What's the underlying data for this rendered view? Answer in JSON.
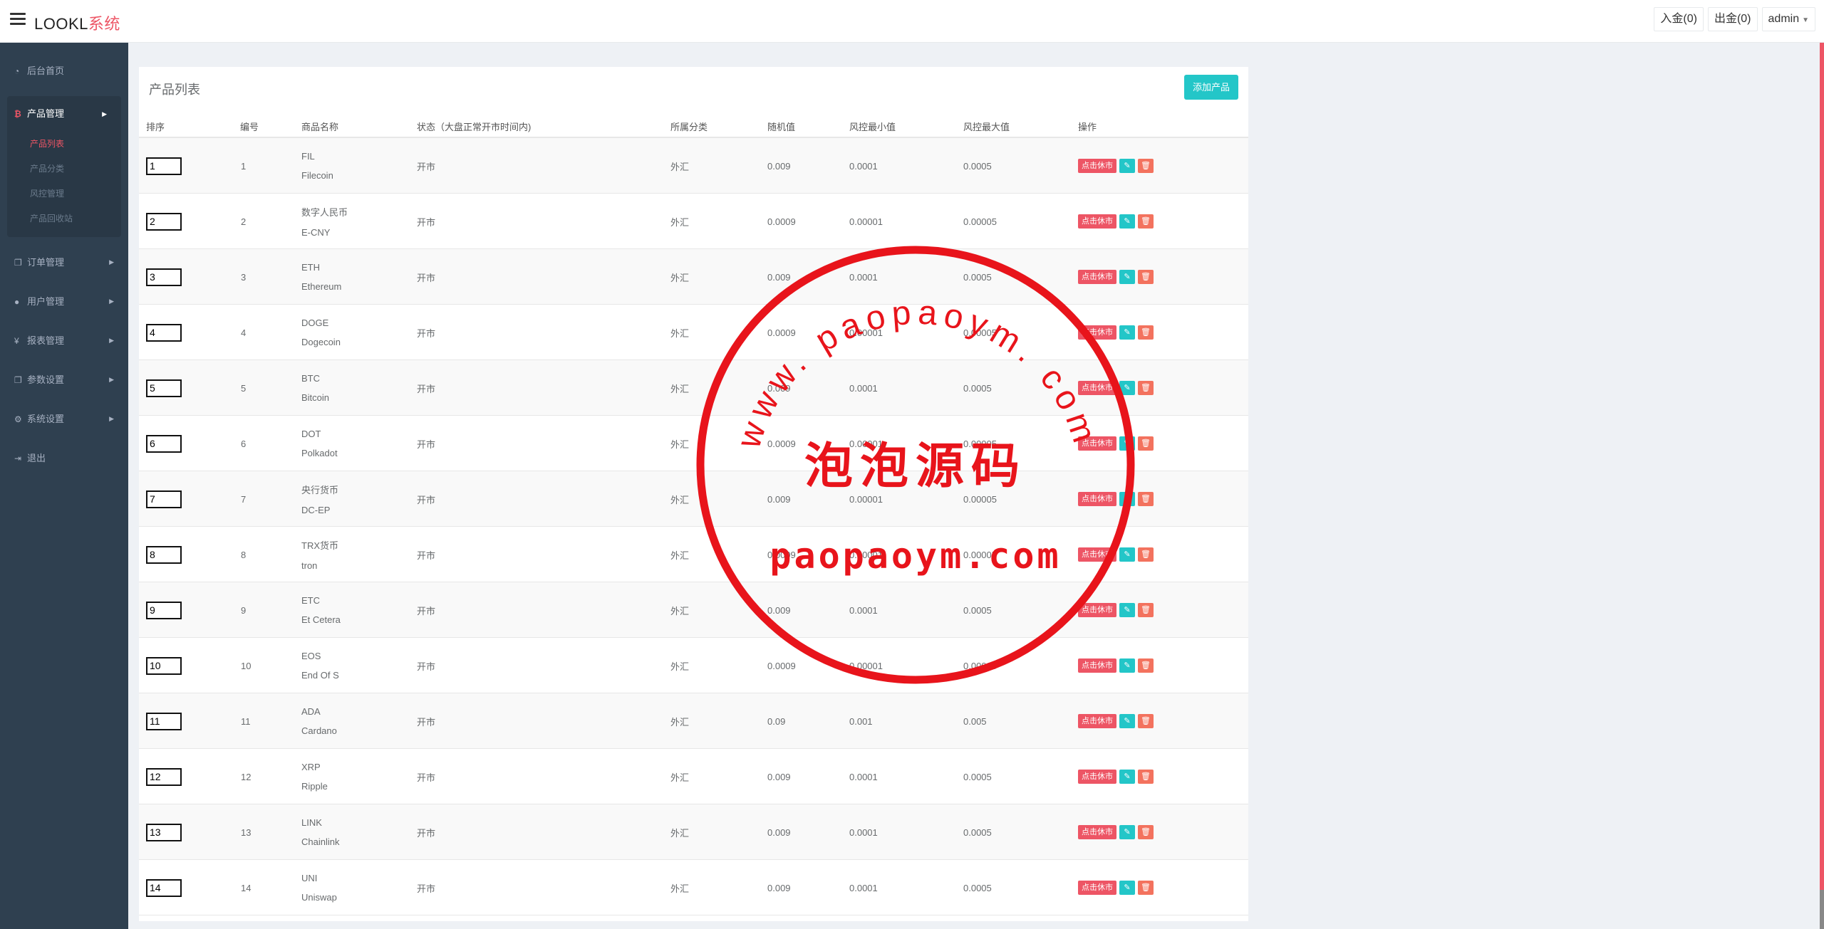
{
  "header": {
    "brand_main": "LOOKL",
    "brand_accent": "系统",
    "deposit": "入金(0)",
    "withdraw": "出金(0)",
    "user": "admin"
  },
  "sidebar": {
    "items": [
      {
        "label": "后台首页",
        "icon": "dashboard-icon"
      },
      {
        "label": "产品管理",
        "icon": "bitcoin-icon"
      },
      {
        "label": "订单管理",
        "icon": "copy-icon"
      },
      {
        "label": "用户管理",
        "icon": "user-icon"
      },
      {
        "label": "报表管理",
        "icon": "yen-icon"
      },
      {
        "label": "参数设置",
        "icon": "copy-icon"
      },
      {
        "label": "系统设置",
        "icon": "gears-icon"
      },
      {
        "label": "退出",
        "icon": "sign-out-icon"
      }
    ],
    "sub_items": [
      "产品列表",
      "产品分类",
      "风控管理",
      "产品回收站"
    ]
  },
  "panel": {
    "title": "产品列表",
    "add_button": "添加产品"
  },
  "table": {
    "headers": [
      "排序",
      "编号",
      "商品名称",
      "状态（大盘正常开市时间内)",
      "所属分类",
      "随机值",
      "风控最小值",
      "风控最大值",
      "操作"
    ],
    "op_label": "点击休市",
    "rows": [
      {
        "sort": "1",
        "id": "1",
        "code": "FIL",
        "name": "Filecoin",
        "status": "开市",
        "category": "外汇",
        "random": "0.009",
        "min": "0.0001",
        "max": "0.0005"
      },
      {
        "sort": "2",
        "id": "2",
        "code": "数字人民币",
        "name": "E-CNY",
        "status": "开市",
        "category": "外汇",
        "random": "0.0009",
        "min": "0.00001",
        "max": "0.00005"
      },
      {
        "sort": "3",
        "id": "3",
        "code": "ETH",
        "name": "Ethereum",
        "status": "开市",
        "category": "外汇",
        "random": "0.009",
        "min": "0.0001",
        "max": "0.0005"
      },
      {
        "sort": "4",
        "id": "4",
        "code": "DOGE",
        "name": "Dogecoin",
        "status": "开市",
        "category": "外汇",
        "random": "0.0009",
        "min": "0.00001",
        "max": "0.00005"
      },
      {
        "sort": "5",
        "id": "5",
        "code": "BTC",
        "name": "Bitcoin",
        "status": "开市",
        "category": "外汇",
        "random": "0.009",
        "min": "0.0001",
        "max": "0.0005"
      },
      {
        "sort": "6",
        "id": "6",
        "code": "DOT",
        "name": "Polkadot",
        "status": "开市",
        "category": "外汇",
        "random": "0.0009",
        "min": "0.00001",
        "max": "0.00005"
      },
      {
        "sort": "7",
        "id": "7",
        "code": "央行货币",
        "name": "DC-EP",
        "status": "开市",
        "category": "外汇",
        "random": "0.009",
        "min": "0.00001",
        "max": "0.00005"
      },
      {
        "sort": "8",
        "id": "8",
        "code": "TRX货币",
        "name": "tron",
        "status": "开市",
        "category": "外汇",
        "random": "0.0009",
        "min": "0.00001",
        "max": "0.00005"
      },
      {
        "sort": "9",
        "id": "9",
        "code": "ETC",
        "name": "Et Cetera",
        "status": "开市",
        "category": "外汇",
        "random": "0.009",
        "min": "0.0001",
        "max": "0.0005"
      },
      {
        "sort": "10",
        "id": "10",
        "code": "EOS",
        "name": "End Of S",
        "status": "开市",
        "category": "外汇",
        "random": "0.0009",
        "min": "0.00001",
        "max": "0.00005"
      },
      {
        "sort": "11",
        "id": "11",
        "code": "ADA",
        "name": "Cardano",
        "status": "开市",
        "category": "外汇",
        "random": "0.09",
        "min": "0.001",
        "max": "0.005"
      },
      {
        "sort": "12",
        "id": "12",
        "code": "XRP",
        "name": "Ripple",
        "status": "开市",
        "category": "外汇",
        "random": "0.009",
        "min": "0.0001",
        "max": "0.0005"
      },
      {
        "sort": "13",
        "id": "13",
        "code": "LINK",
        "name": "Chainlink",
        "status": "开市",
        "category": "外汇",
        "random": "0.009",
        "min": "0.0001",
        "max": "0.0005"
      },
      {
        "sort": "14",
        "id": "14",
        "code": "UNI",
        "name": "Uniswap",
        "status": "开市",
        "category": "外汇",
        "random": "0.009",
        "min": "0.0001",
        "max": "0.0005"
      }
    ]
  },
  "watermark": {
    "arc_text": "www. paopaoym. com",
    "center_text": "泡泡源码",
    "bottom_text": "paopaoym.com"
  },
  "colors": {
    "accent": "#ed5565",
    "teal": "#23c6c8",
    "sidebar": "#2f4050",
    "stamp": "#e8141b"
  }
}
